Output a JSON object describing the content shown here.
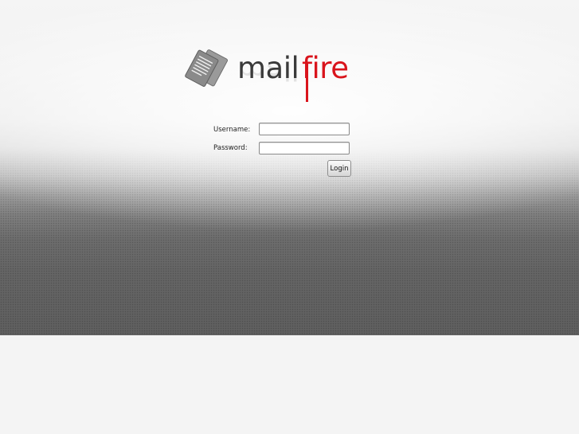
{
  "logo": {
    "word_mail": "mail",
    "word_fire": "fire",
    "icon": "documents-icon",
    "colors": {
      "mail": "#3a3a3a",
      "fire": "#d9141c"
    }
  },
  "form": {
    "username_label": "Username:",
    "username_value": "",
    "password_label": "Password:",
    "password_value": "",
    "login_label": "Login"
  }
}
